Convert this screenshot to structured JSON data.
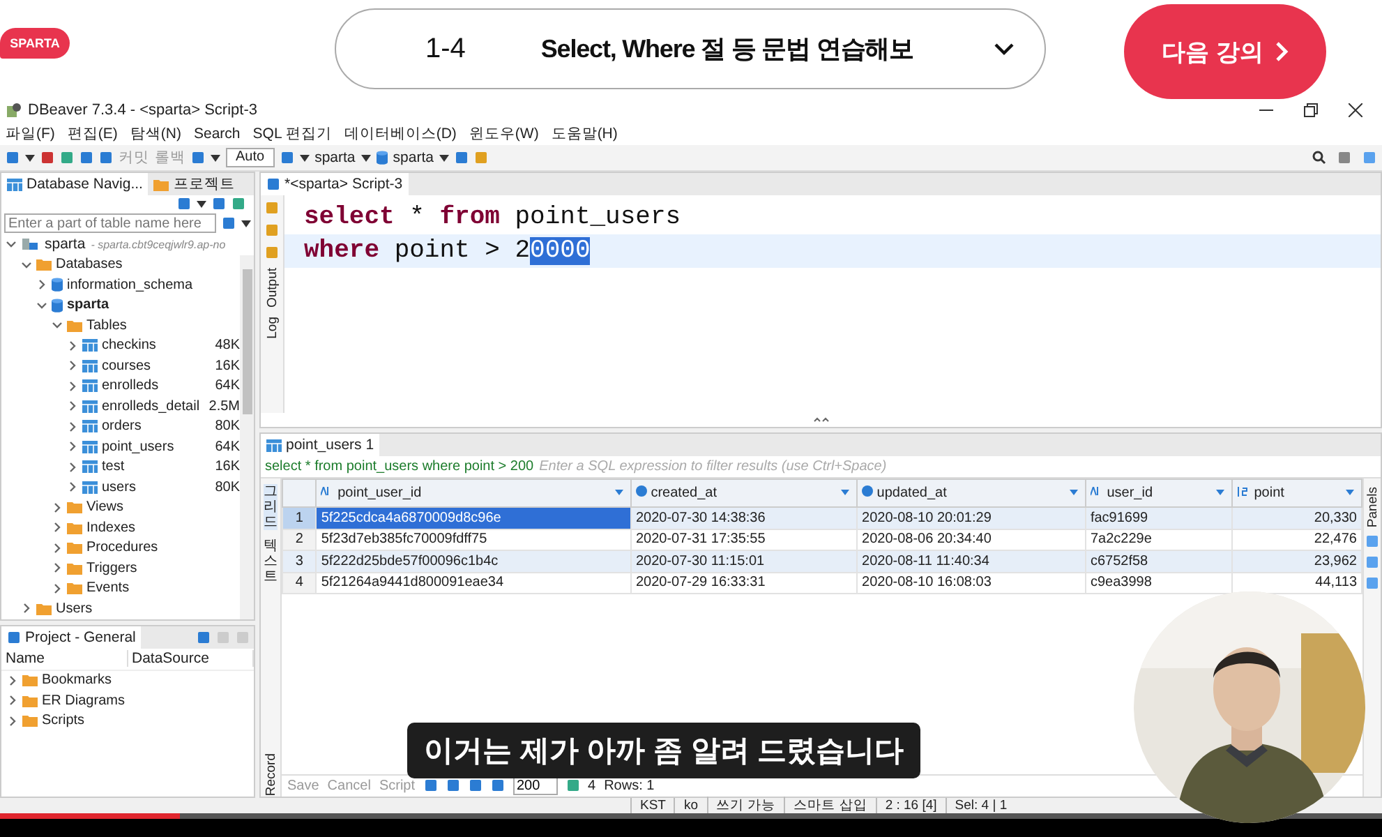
{
  "header": {
    "logo": "SPARTA",
    "lecture_number": "1-4",
    "lecture_title": "Select, Where 절 등 문법 연습해보",
    "next_button": "다음 강의"
  },
  "window": {
    "title": "DBeaver 7.3.4 - <sparta> Script-3"
  },
  "menu": [
    "파일(F)",
    "편집(E)",
    "탐색(N)",
    "Search",
    "SQL 편집기",
    "데이터베이스(D)",
    "윈도우(W)",
    "도움말(H)"
  ],
  "toolbar": {
    "buttons": [
      {
        "label": "커밋",
        "disabled": true
      },
      {
        "label": "롤백",
        "disabled": true
      }
    ],
    "commit_mode": "Auto",
    "connection": "sparta",
    "schema": "sparta"
  },
  "navigator": {
    "tabs": [
      {
        "label": "Database Navig...",
        "selected": true
      },
      {
        "label": "프로젝트",
        "selected": false
      }
    ],
    "filter": {
      "placeholder": "Enter a part of table name here"
    },
    "tree": [
      {
        "label": "sparta",
        "kind": "connection",
        "note": "- sparta.cbt9ceqjwlr9.ap-no",
        "expanded": true,
        "children": [
          {
            "label": "Databases",
            "kind": "folder",
            "expanded": true,
            "children": [
              {
                "label": "information_schema",
                "kind": "database",
                "default": false,
                "expanded": false
              },
              {
                "label": "sparta",
                "kind": "database",
                "default": true,
                "expanded": true,
                "children": [
                  {
                    "label": "Tables",
                    "kind": "folder",
                    "expanded": true,
                    "children": [
                      {
                        "label": "checkins",
                        "kind": "table",
                        "size": "48K",
                        "expanded": false
                      },
                      {
                        "label": "courses",
                        "kind": "table",
                        "size": "16K",
                        "expanded": false
                      },
                      {
                        "label": "enrolleds",
                        "kind": "table",
                        "size": "64K",
                        "expanded": false
                      },
                      {
                        "label": "enrolleds_detail",
                        "kind": "table",
                        "size": "2.5M",
                        "expanded": false
                      },
                      {
                        "label": "orders",
                        "kind": "table",
                        "size": "80K",
                        "expanded": false
                      },
                      {
                        "label": "point_users",
                        "kind": "table",
                        "size": "64K",
                        "expanded": false
                      },
                      {
                        "label": "test",
                        "kind": "table",
                        "size": "16K",
                        "expanded": false
                      },
                      {
                        "label": "users",
                        "kind": "table",
                        "size": "80K",
                        "expanded": false
                      }
                    ]
                  },
                  {
                    "label": "Views",
                    "kind": "folder",
                    "expanded": false
                  },
                  {
                    "label": "Indexes",
                    "kind": "folder",
                    "expanded": false
                  },
                  {
                    "label": "Procedures",
                    "kind": "folder",
                    "expanded": false
                  },
                  {
                    "label": "Triggers",
                    "kind": "folder",
                    "expanded": false
                  },
                  {
                    "label": "Events",
                    "kind": "folder",
                    "expanded": false
                  }
                ]
              }
            ]
          },
          {
            "label": "Users",
            "kind": "folder",
            "expanded": false
          }
        ]
      }
    ]
  },
  "project": {
    "title": "Project - General",
    "columns": [
      "Name",
      "DataSource"
    ],
    "items": [
      "Bookmarks",
      "ER Diagrams",
      "Scripts"
    ]
  },
  "editor": {
    "tab": "*<sparta> Script-3",
    "side_tabs": [
      "Output",
      "Log"
    ],
    "lines": [
      {
        "current": false,
        "tokens": [
          {
            "kind": "keyword",
            "text": "select"
          },
          {
            "kind": "plain",
            "text": " * "
          },
          {
            "kind": "keyword",
            "text": "from"
          },
          {
            "kind": "plain",
            "text": " point_users"
          }
        ]
      },
      {
        "current": true,
        "tokens": [
          {
            "kind": "keyword",
            "text": "where"
          },
          {
            "kind": "plain",
            "text": " point > 2"
          },
          {
            "kind": "selection",
            "text": "0000"
          }
        ]
      }
    ]
  },
  "results": {
    "tab": "point_users 1",
    "query": "select * from point_users where point > 200",
    "filter": {
      "placeholder": "Enter a SQL expression to filter results (use Ctrl+Space)"
    },
    "view_tabs": [
      "그리드",
      "텍스트"
    ],
    "side_tabs": [
      "Record"
    ],
    "columns": [
      {
        "label": "point_user_id",
        "kind": "text"
      },
      {
        "label": "created_at",
        "kind": "datetime"
      },
      {
        "label": "updated_at",
        "kind": "datetime"
      },
      {
        "label": "user_id",
        "kind": "text"
      },
      {
        "label": "point",
        "kind": "number"
      }
    ],
    "rows": [
      {
        "number": "1",
        "selected": true,
        "cells": [
          "5f225cdca4a6870009d8c96e",
          "2020-07-30 14:38:36",
          "2020-08-10 20:01:29",
          "fac91699",
          "20,330"
        ]
      },
      {
        "number": "2",
        "selected": false,
        "cells": [
          "5f23d7eb385fc70009fdff75",
          "2020-07-31 17:35:55",
          "2020-08-06 20:34:40",
          "7a2c229e",
          "22,476"
        ]
      },
      {
        "number": "3",
        "selected": false,
        "cells": [
          "5f222d25bde57f00096c1b4c",
          "2020-07-30 11:15:01",
          "2020-08-11 11:40:34",
          "c6752f58",
          "23,962"
        ]
      },
      {
        "number": "4",
        "selected": false,
        "cells": [
          "5f21264a9441d800091eae34",
          "2020-07-29 16:33:31",
          "2020-08-10 16:08:03",
          "c9ea3998",
          "44,113"
        ]
      }
    ],
    "toolbar": {
      "buttons": [
        "Save",
        "Cancel",
        "Script"
      ],
      "fetch_size": "200",
      "count": "4",
      "rows_label": "Rows: 1"
    },
    "panels_label": "Panels"
  },
  "status_bar": [
    "KST",
    "ko",
    "쓰기 가능",
    "스마트 삽입",
    "2 : 16 [4]",
    "Sel: 4 | 1"
  ],
  "video": {
    "subtitle": "이거는 제가 아까 좀 알려 드렸습니다",
    "progress": {
      "level": 0.13
    }
  }
}
